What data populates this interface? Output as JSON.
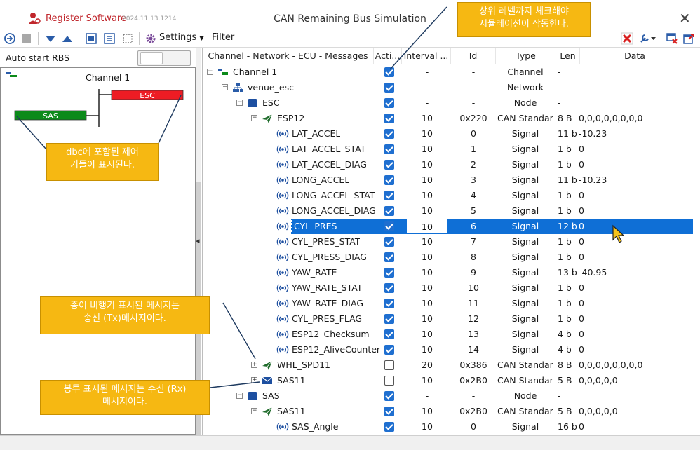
{
  "app": {
    "name": "Register Software",
    "version_date": "2024.11.13.1214",
    "window_title": "CAN Remaining Bus Simulation"
  },
  "toolbar": {
    "settings_label": "Settings",
    "filter_label": "Filter"
  },
  "left": {
    "autostart_label": "Auto start RBS",
    "channel_label": "Channel 1",
    "nodes": [
      {
        "label": "ESC",
        "color": "#ee1c24"
      },
      {
        "label": "SAS",
        "color": "#0c8a1a"
      }
    ]
  },
  "grid": {
    "headers": [
      "Channel - Network - ECU - Messages",
      "Acti...",
      "Interval ...",
      "Id",
      "Type",
      "Len",
      "Data"
    ],
    "rows": [
      {
        "level": 0,
        "exp": "minus",
        "icon": "channel",
        "name": "Channel 1",
        "active": true,
        "interval": "-",
        "id": "-",
        "type": "Channel",
        "len": "-",
        "data": ""
      },
      {
        "level": 1,
        "exp": "minus",
        "icon": "network",
        "name": "venue_esc",
        "active": true,
        "interval": "-",
        "id": "-",
        "type": "Network",
        "len": "-",
        "data": ""
      },
      {
        "level": 2,
        "exp": "minus",
        "icon": "node",
        "name": "ESC",
        "active": true,
        "interval": "-",
        "id": "-",
        "type": "Node",
        "len": "-",
        "data": ""
      },
      {
        "level": 3,
        "exp": "minus",
        "icon": "tx",
        "name": "ESP12",
        "active": true,
        "interval": "10",
        "id": "0x220",
        "type": "CAN Standard",
        "len": "8 B",
        "data": "0,0,0,0,0,0,0,0"
      },
      {
        "level": 4,
        "icon": "signal",
        "name": "LAT_ACCEL",
        "active": true,
        "interval": "10",
        "id": "0",
        "type": "Signal",
        "len": "11 b",
        "data": "-10.23"
      },
      {
        "level": 4,
        "icon": "signal",
        "name": "LAT_ACCEL_STAT",
        "active": true,
        "interval": "10",
        "id": "1",
        "type": "Signal",
        "len": "1 b",
        "data": "0"
      },
      {
        "level": 4,
        "icon": "signal",
        "name": "LAT_ACCEL_DIAG",
        "active": true,
        "interval": "10",
        "id": "2",
        "type": "Signal",
        "len": "1 b",
        "data": "0"
      },
      {
        "level": 4,
        "icon": "signal",
        "name": "LONG_ACCEL",
        "active": true,
        "interval": "10",
        "id": "3",
        "type": "Signal",
        "len": "11 b",
        "data": "-10.23"
      },
      {
        "level": 4,
        "icon": "signal",
        "name": "LONG_ACCEL_STAT",
        "active": true,
        "interval": "10",
        "id": "4",
        "type": "Signal",
        "len": "1 b",
        "data": "0"
      },
      {
        "level": 4,
        "icon": "signal",
        "name": "LONG_ACCEL_DIAG",
        "active": true,
        "interval": "10",
        "id": "5",
        "type": "Signal",
        "len": "1 b",
        "data": "0"
      },
      {
        "level": 4,
        "icon": "signal",
        "name": "CYL_PRES",
        "active": true,
        "interval": "10",
        "id": "6",
        "type": "Signal",
        "len": "12 b",
        "data": "0",
        "selected": true
      },
      {
        "level": 4,
        "icon": "signal",
        "name": "CYL_PRES_STAT",
        "active": true,
        "interval": "10",
        "id": "7",
        "type": "Signal",
        "len": "1 b",
        "data": "0"
      },
      {
        "level": 4,
        "icon": "signal",
        "name": "CYL_PRESS_DIAG",
        "active": true,
        "interval": "10",
        "id": "8",
        "type": "Signal",
        "len": "1 b",
        "data": "0"
      },
      {
        "level": 4,
        "icon": "signal",
        "name": "YAW_RATE",
        "active": true,
        "interval": "10",
        "id": "9",
        "type": "Signal",
        "len": "13 b",
        "data": "-40.95"
      },
      {
        "level": 4,
        "icon": "signal",
        "name": "YAW_RATE_STAT",
        "active": true,
        "interval": "10",
        "id": "10",
        "type": "Signal",
        "len": "1 b",
        "data": "0"
      },
      {
        "level": 4,
        "icon": "signal",
        "name": "YAW_RATE_DIAG",
        "active": true,
        "interval": "10",
        "id": "11",
        "type": "Signal",
        "len": "1 b",
        "data": "0"
      },
      {
        "level": 4,
        "icon": "signal",
        "name": "CYL_PRES_FLAG",
        "active": true,
        "interval": "10",
        "id": "12",
        "type": "Signal",
        "len": "1 b",
        "data": "0"
      },
      {
        "level": 4,
        "icon": "signal",
        "name": "ESP12_Checksum",
        "active": true,
        "interval": "10",
        "id": "13",
        "type": "Signal",
        "len": "4 b",
        "data": "0"
      },
      {
        "level": 4,
        "icon": "signal",
        "name": "ESP12_AliveCounter",
        "active": true,
        "interval": "10",
        "id": "14",
        "type": "Signal",
        "len": "4 b",
        "data": "0"
      },
      {
        "level": 3,
        "exp": "plus",
        "icon": "tx",
        "name": "WHL_SPD11",
        "active": false,
        "interval": "20",
        "id": "0x386",
        "type": "CAN Standard",
        "len": "8 B",
        "data": "0,0,0,0,0,0,0,0"
      },
      {
        "level": 3,
        "exp": "plus",
        "icon": "rx",
        "name": "SAS11",
        "active": false,
        "interval": "10",
        "id": "0x2B0",
        "type": "CAN Standard",
        "len": "5 B",
        "data": "0,0,0,0,0"
      },
      {
        "level": 2,
        "exp": "minus",
        "icon": "node",
        "name": "SAS",
        "active": true,
        "interval": "-",
        "id": "-",
        "type": "Node",
        "len": "-",
        "data": ""
      },
      {
        "level": 3,
        "exp": "minus",
        "icon": "tx",
        "name": "SAS11",
        "active": true,
        "interval": "10",
        "id": "0x2B0",
        "type": "CAN Standard",
        "len": "5 B",
        "data": "0,0,0,0,0"
      },
      {
        "level": 4,
        "icon": "signal",
        "name": "SAS_Angle",
        "active": true,
        "interval": "10",
        "id": "0",
        "type": "Signal",
        "len": "16 b",
        "data": "0"
      }
    ]
  },
  "annotations": {
    "top": "상위 레벨까지 체크해야\n시뮬레이션이 작동한다.",
    "dbc": "dbc에 포함된 제어\n기들이 표시된다.",
    "tx": "종이 비행기 표시된 메시지는\n송신 (Tx)메시지이다.",
    "rx": "봉투 표시된 메시지는 수신 (Rx)\n메시지이다."
  },
  "colors": {
    "accent": "#0f6fd6",
    "note": "#f6b812",
    "brand": "#c0262c"
  }
}
